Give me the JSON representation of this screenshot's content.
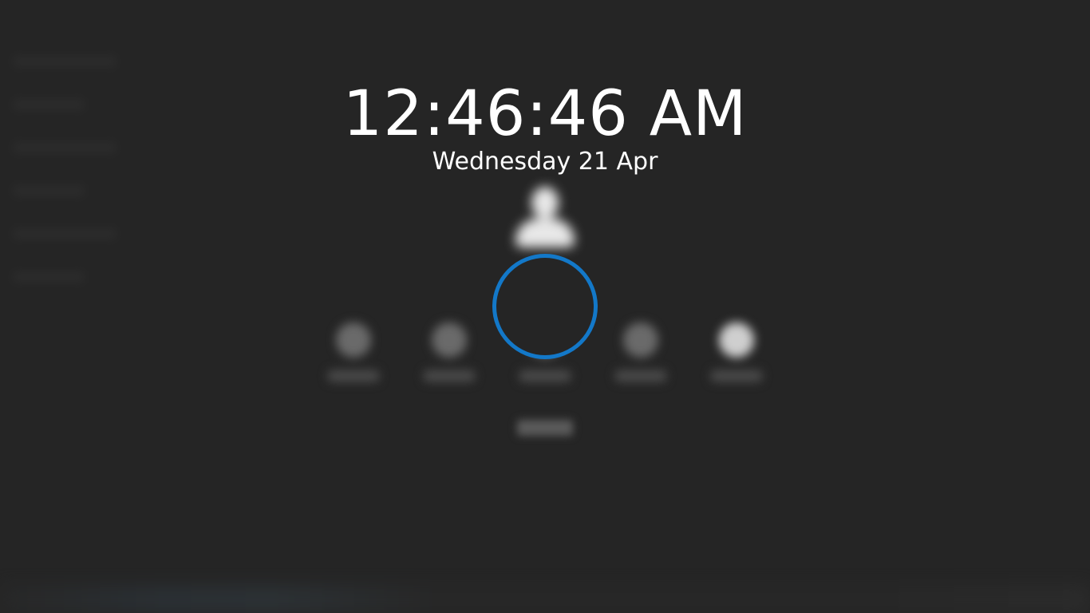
{
  "lockscreen": {
    "time": "12:46:46 AM",
    "date": "Wednesday 21 Apr"
  },
  "colors": {
    "background": "#252525",
    "spinner": "#1378c8",
    "text": "#ffffff"
  },
  "icons": {
    "avatar": "user-avatar-icon",
    "spinner": "loading-spinner"
  }
}
